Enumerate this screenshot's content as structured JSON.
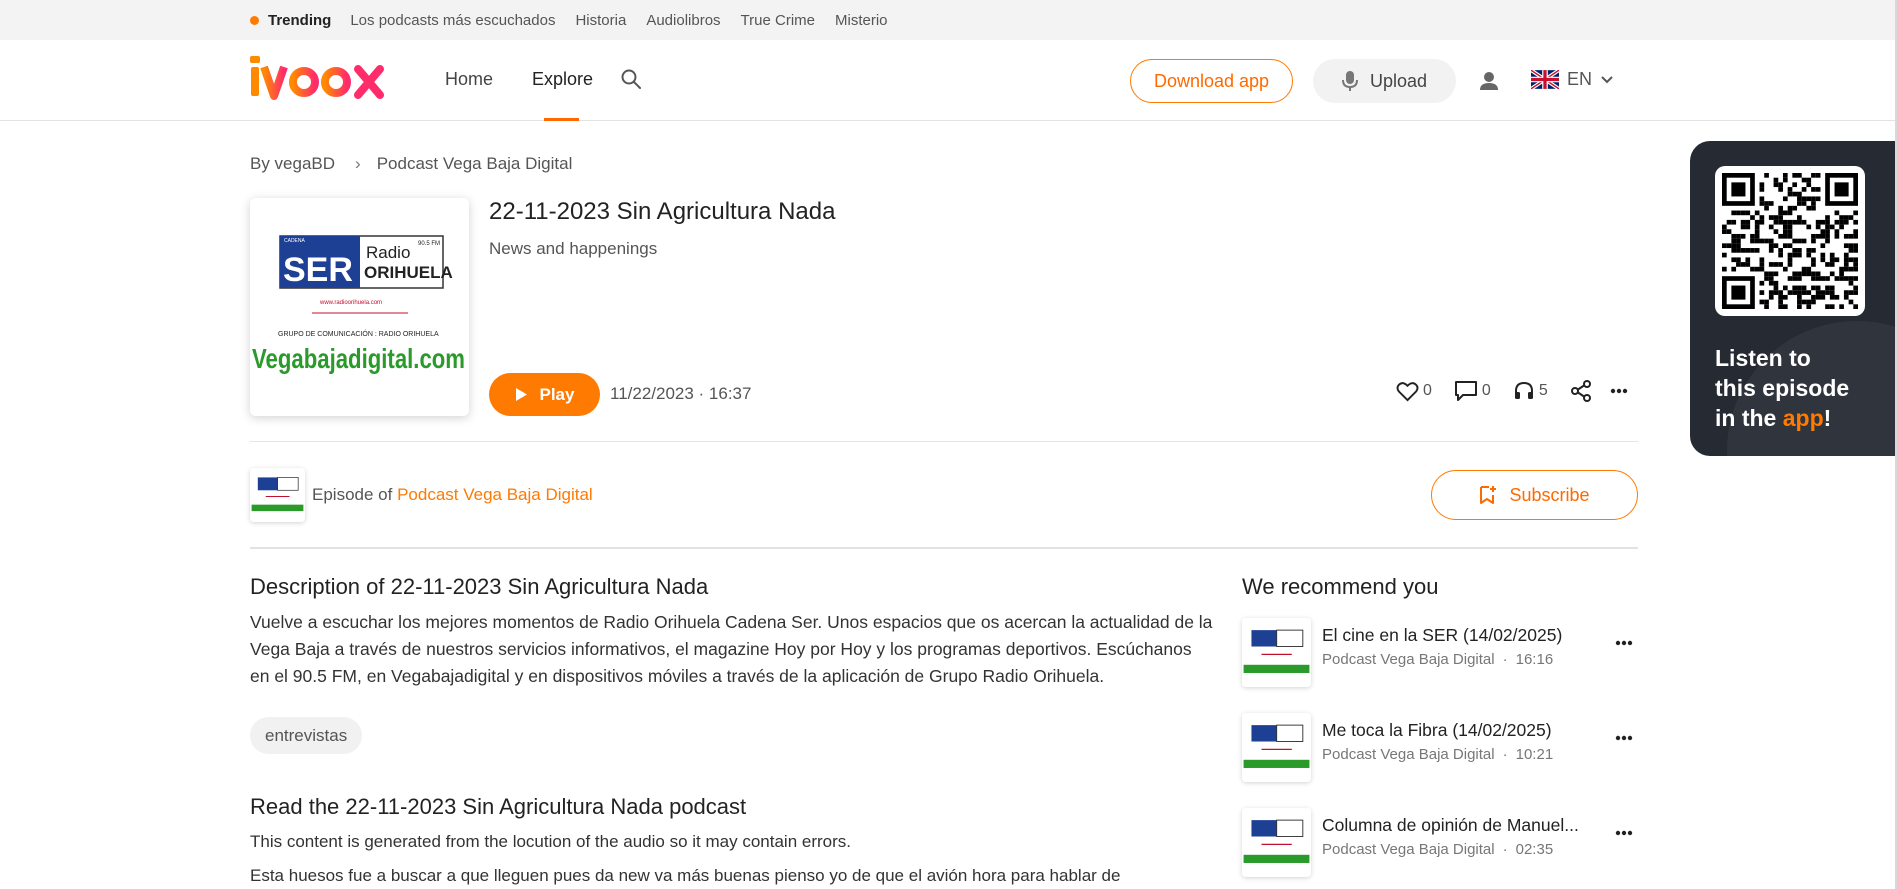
{
  "trending": {
    "label": "Trending",
    "links": [
      "Los podcasts más escuchados",
      "Historia",
      "Audiolibros",
      "True Crime",
      "Misterio"
    ]
  },
  "header": {
    "logo_text": "ivoox",
    "nav": {
      "home": "Home",
      "explore": "Explore"
    },
    "download_app": "Download app",
    "upload": "Upload",
    "language": "EN"
  },
  "breadcrumb": {
    "author": "By vegaBD",
    "podcast": "Podcast Vega Baja Digital"
  },
  "episode": {
    "title": "22-11-2023 Sin Agricultura Nada",
    "category": "News and happenings",
    "play_label": "Play",
    "date": "11/22/2023 · 16:37",
    "likes": "0",
    "comments": "0",
    "listens": "5"
  },
  "cover": {
    "cadena": "CADENA",
    "ser": "SER",
    "radio": "Radio",
    "orihuela": "ORIHUELA",
    "fm": "90.5 FM",
    "url": "www.radioorihuela.com",
    "grupo": "GRUPO DE COMUNICACIÓN : RADIO ORIHUELA",
    "brand": "Vegabajadigital.com"
  },
  "podcast_strip": {
    "episode_of": "Episode of",
    "podcast_name": "Podcast Vega Baja Digital",
    "subscribe": "Subscribe"
  },
  "description": {
    "title": "Description of 22-11-2023 Sin Agricultura Nada",
    "text": "Vuelve a escuchar los mejores momentos de Radio Orihuela Cadena Ser. Unos espacios que os acercan la actualidad de la Vega Baja a través de nuestros servicios informativos, el magazine Hoy por Hoy y los programas deportivos. Escúchanos en el 90.5 FM, en Vegabajadigital y en dispositivos móviles a través de la aplicación de Grupo Radio Orihuela.",
    "tag": "entrevistas"
  },
  "transcript": {
    "title": "Read the 22-11-2023 Sin Agricultura Nada podcast",
    "note": "This content is generated from the locution of the audio so it may contain errors.",
    "body": "Esta huesos fue a buscar a que lleguen pues da new va más buenas pienso yo de que el avión hora para hablar de"
  },
  "recommendations": {
    "title": "We recommend you",
    "items": [
      {
        "name": "El cine en la SER (14/02/2025)",
        "podcast": "Podcast Vega Baja Digital",
        "duration": "16:16"
      },
      {
        "name": "Me toca la Fibra (14/02/2025)",
        "podcast": "Podcast Vega Baja Digital",
        "duration": "10:21"
      },
      {
        "name": "Columna de opinión de Manuel...",
        "podcast": "Podcast Vega Baja Digital",
        "duration": "02:35"
      }
    ]
  },
  "promo": {
    "line1": "Listen to",
    "line2": "this episode",
    "line3_prefix": "in the ",
    "line3_app": "app",
    "line3_suffix": "!"
  },
  "colors": {
    "accent": "#ff7a00",
    "logo_pink": "#ff2b6b",
    "promo_bg": "#262b33"
  }
}
